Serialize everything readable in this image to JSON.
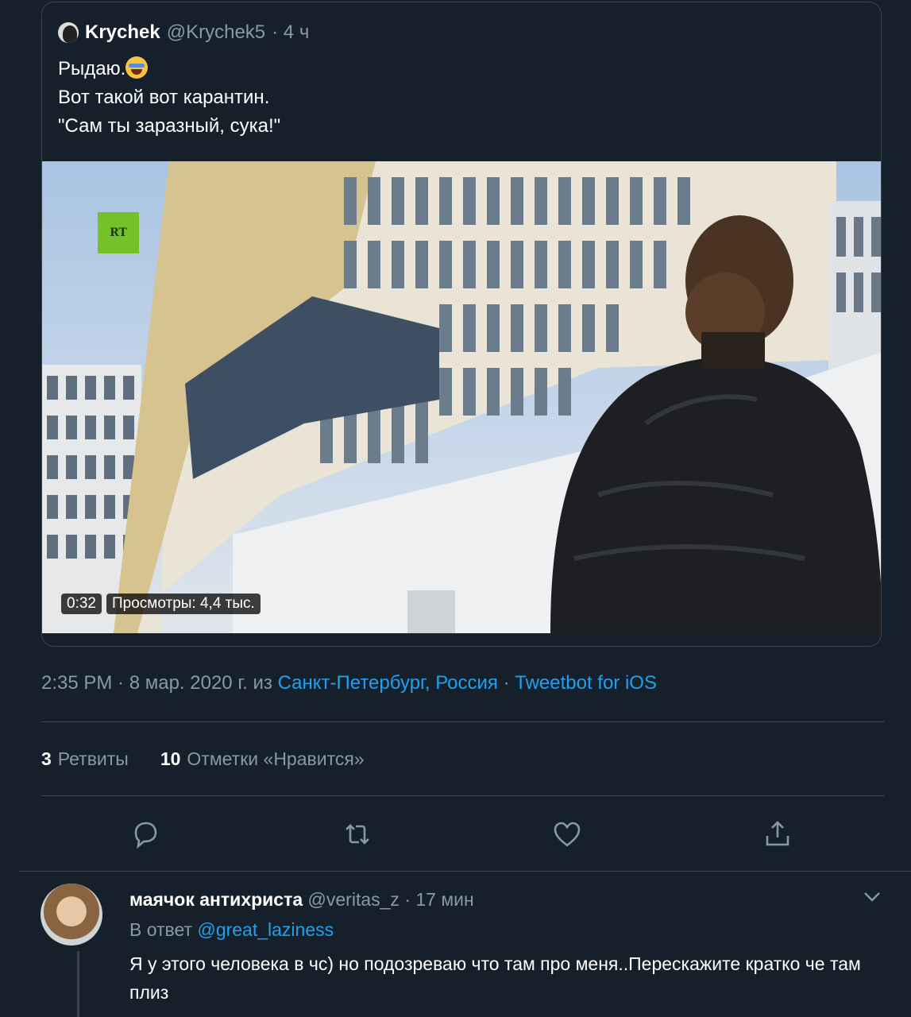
{
  "quoted_tweet": {
    "author_name": "Krychek",
    "author_handle": "@Krychek5",
    "time": "· 4 ч",
    "text_line1": "Рыдаю.",
    "emoji": "joy-emoji",
    "text_line2": "Вот такой вот карантин.",
    "text_line3": "\"Сам ты заразный, сука!\"",
    "video": {
      "logo": "RT",
      "duration": "0:32",
      "views": "Просмотры: 4,4 тыс."
    }
  },
  "meta": {
    "timestamp": "2:35 PM · 8 мар. 2020 г. из ",
    "location": "Санкт-Петербург, Россия",
    "separator": " · ",
    "client": "Tweetbot for iOS"
  },
  "stats": {
    "retweets_count": "3",
    "retweets_label": "Ретвиты",
    "likes_count": "10",
    "likes_label": "Отметки «Нравится»"
  },
  "actions": [
    "reply-icon",
    "retweet-icon",
    "like-icon",
    "share-icon"
  ],
  "reply_tweet": {
    "author_name": "маячок антихриста",
    "author_handle": "@veritas_z",
    "time": "· 17 мин",
    "reply_prefix": "В ответ ",
    "reply_to": "@great_laziness",
    "text": "Я у этого человека в чс) но подозреваю что там про меня..Перескажите кратко че там плиз"
  },
  "colors": {
    "background": "#15202b",
    "border": "#38444d",
    "muted": "#8899a6",
    "link": "#1da1f2"
  }
}
